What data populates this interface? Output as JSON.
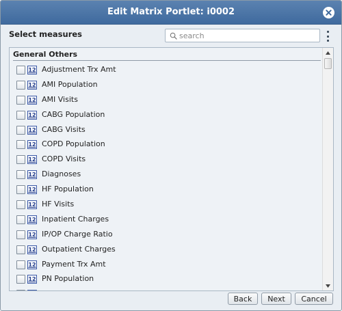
{
  "dialog": {
    "title": "Edit Matrix Portlet: i0002"
  },
  "toolbar": {
    "select_label": "Select measures",
    "search_placeholder": "search"
  },
  "list": {
    "group_title": "General Others",
    "items": [
      {
        "label": "Adjustment Trx Amt",
        "icon": "12",
        "checked": false
      },
      {
        "label": "AMI Population",
        "icon": "12",
        "checked": false
      },
      {
        "label": "AMI Visits",
        "icon": "12",
        "checked": false
      },
      {
        "label": "CABG Population",
        "icon": "12",
        "checked": false
      },
      {
        "label": "CABG Visits",
        "icon": "12",
        "checked": false
      },
      {
        "label": "COPD Population",
        "icon": "12",
        "checked": false
      },
      {
        "label": "COPD Visits",
        "icon": "12",
        "checked": false
      },
      {
        "label": "Diagnoses",
        "icon": "12",
        "checked": false
      },
      {
        "label": "HF Population",
        "icon": "12",
        "checked": false
      },
      {
        "label": "HF Visits",
        "icon": "12",
        "checked": false
      },
      {
        "label": "Inpatient Charges",
        "icon": "12",
        "checked": false
      },
      {
        "label": "IP/OP Charge Ratio",
        "icon": "12",
        "checked": false
      },
      {
        "label": "Outpatient Charges",
        "icon": "12",
        "checked": false
      },
      {
        "label": "Payment Trx Amt",
        "icon": "12",
        "checked": false
      },
      {
        "label": "PN Population",
        "icon": "12",
        "checked": false
      },
      {
        "label": "",
        "icon": "12",
        "checked": false
      }
    ]
  },
  "buttons": {
    "back": "Back",
    "next": "Next",
    "cancel": "Cancel"
  },
  "colors": {
    "titlebar": "#4a74a6",
    "panel_bg": "#eef2f6",
    "dialog_bg": "#e9eef3"
  }
}
